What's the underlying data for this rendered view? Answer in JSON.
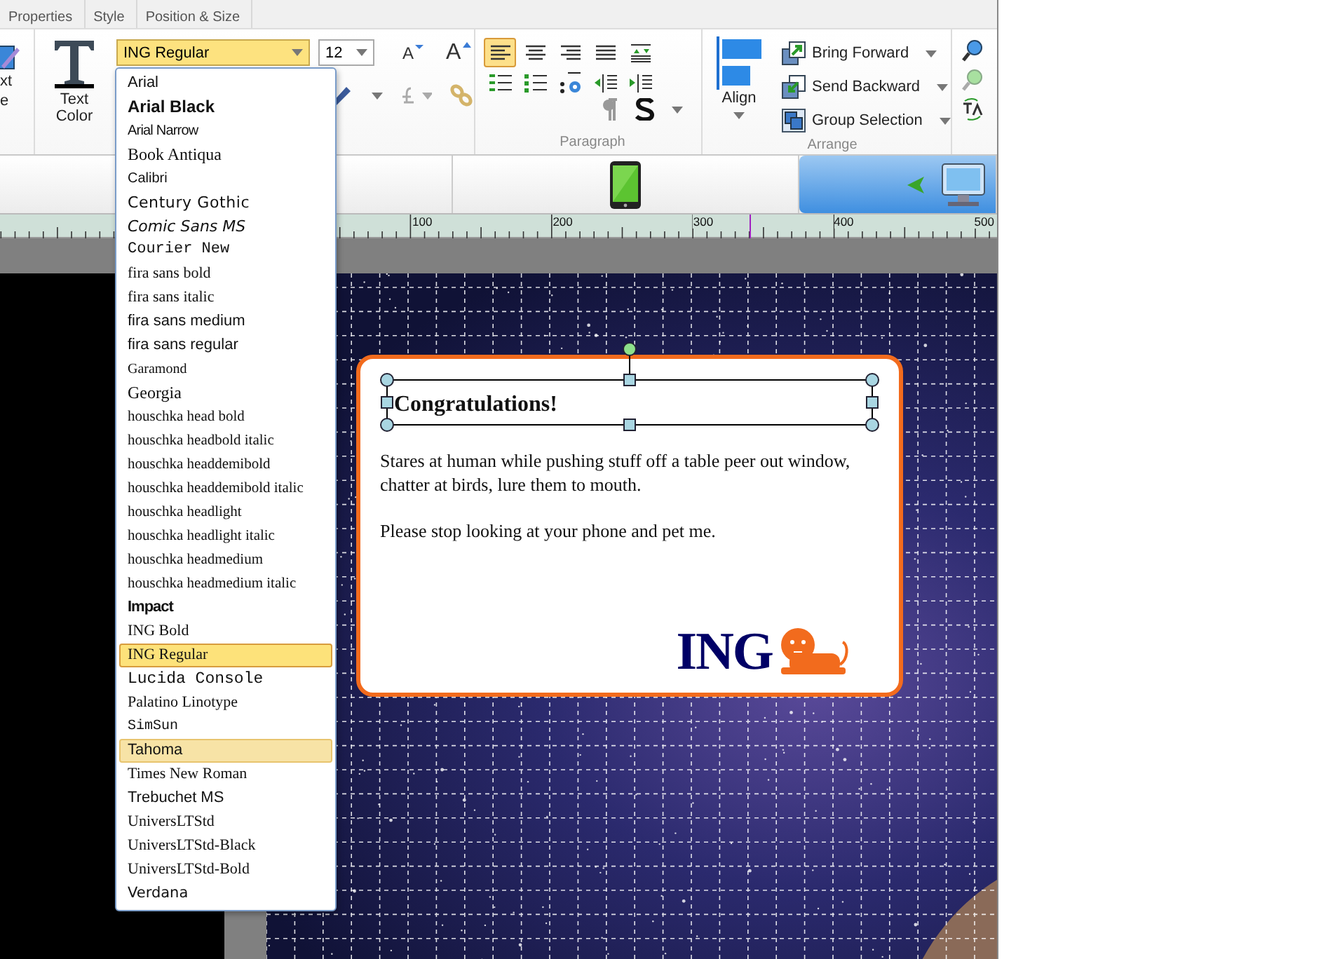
{
  "tabs": [
    {
      "label": "Properties"
    },
    {
      "label": "Style"
    },
    {
      "label": "Position & Size"
    }
  ],
  "ribbon": {
    "cut_labels": [
      "xt",
      "e"
    ],
    "text_color_button": {
      "label": "Text Color"
    },
    "font_combo": {
      "value": "ING Regular"
    },
    "size_combo": {
      "value": "12"
    },
    "font_size_buttons": [
      {
        "kind": "shrink",
        "glyph": "A"
      },
      {
        "kind": "grow",
        "glyph": "A"
      }
    ],
    "paragraph": {
      "label": "Paragraph",
      "align_buttons": [
        {
          "kind": "left",
          "selected": true
        },
        {
          "kind": "center",
          "selected": false
        },
        {
          "kind": "right",
          "selected": false
        },
        {
          "kind": "justify",
          "selected": false
        },
        {
          "kind": "spacing",
          "selected": false
        }
      ]
    },
    "arrange": {
      "label": "Arrange",
      "align_button": {
        "label": "Align"
      },
      "commands": [
        {
          "kind": "forward",
          "label": "Bring Forward"
        },
        {
          "kind": "backward",
          "label": "Send Backward"
        },
        {
          "kind": "group",
          "label": "Group Selection"
        }
      ]
    }
  },
  "device_bar": {
    "devices": [
      {
        "kind": "blank",
        "selected": false
      },
      {
        "kind": "phone",
        "selected": false
      },
      {
        "kind": "desktop",
        "selected": true
      }
    ]
  },
  "ruler": {
    "labels": [
      "100",
      "200",
      "300",
      "400",
      "500"
    ]
  },
  "card": {
    "title": "Congratulations!",
    "paragraphs": [
      "Stares at human while pushing stuff off a table peer out window, chatter at birds, lure them to mouth.",
      "Please stop looking at your phone and pet me."
    ],
    "logo_text": "ING"
  },
  "font_menu": {
    "items": [
      {
        "name": "Arial",
        "selected": false,
        "highlighted": false
      },
      {
        "name": "Arial Black",
        "selected": false,
        "highlighted": false
      },
      {
        "name": "Arial Narrow",
        "selected": false,
        "highlighted": false
      },
      {
        "name": "Book Antiqua",
        "selected": false,
        "highlighted": false
      },
      {
        "name": "Calibri",
        "selected": false,
        "highlighted": false
      },
      {
        "name": "Century Gothic",
        "selected": false,
        "highlighted": false
      },
      {
        "name": "Comic Sans MS",
        "selected": false,
        "highlighted": false
      },
      {
        "name": "Courier New",
        "selected": false,
        "highlighted": false
      },
      {
        "name": "fira sans bold",
        "selected": false,
        "highlighted": false
      },
      {
        "name": "fira sans italic",
        "selected": false,
        "highlighted": false
      },
      {
        "name": "fira sans medium",
        "selected": false,
        "highlighted": false
      },
      {
        "name": "fira sans regular",
        "selected": false,
        "highlighted": false
      },
      {
        "name": "Garamond",
        "selected": false,
        "highlighted": false
      },
      {
        "name": "Georgia",
        "selected": false,
        "highlighted": false
      },
      {
        "name": "houschka head bold",
        "selected": false,
        "highlighted": false
      },
      {
        "name": "houschka headbold italic",
        "selected": false,
        "highlighted": false
      },
      {
        "name": "houschka headdemibold",
        "selected": false,
        "highlighted": false
      },
      {
        "name": "houschka headdemibold italic",
        "selected": false,
        "highlighted": false
      },
      {
        "name": "houschka headlight",
        "selected": false,
        "highlighted": false
      },
      {
        "name": "houschka headlight italic",
        "selected": false,
        "highlighted": false
      },
      {
        "name": "houschka headmedium",
        "selected": false,
        "highlighted": false
      },
      {
        "name": "houschka headmedium italic",
        "selected": false,
        "highlighted": false
      },
      {
        "name": "Impact",
        "selected": false,
        "highlighted": false
      },
      {
        "name": "ING Bold",
        "selected": false,
        "highlighted": false
      },
      {
        "name": "ING Regular",
        "selected": true,
        "highlighted": false
      },
      {
        "name": "Lucida Console",
        "selected": false,
        "highlighted": false
      },
      {
        "name": "Palatino Linotype",
        "selected": false,
        "highlighted": false
      },
      {
        "name": "SimSun",
        "selected": false,
        "highlighted": false
      },
      {
        "name": "Tahoma",
        "selected": false,
        "highlighted": true
      },
      {
        "name": "Times New Roman",
        "selected": false,
        "highlighted": false
      },
      {
        "name": "Trebuchet MS",
        "selected": false,
        "highlighted": false
      },
      {
        "name": "UniversLTStd",
        "selected": false,
        "highlighted": false
      },
      {
        "name": "UniversLTStd-Black",
        "selected": false,
        "highlighted": false
      },
      {
        "name": "UniversLTStd-Bold",
        "selected": false,
        "highlighted": false
      },
      {
        "name": "Verdana",
        "selected": false,
        "highlighted": false
      }
    ]
  }
}
